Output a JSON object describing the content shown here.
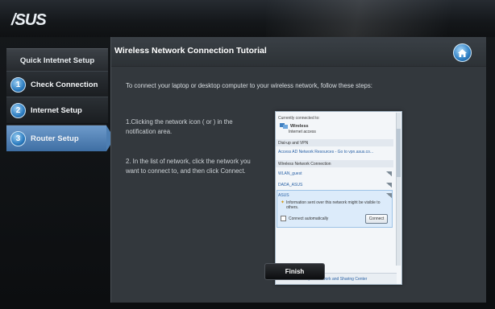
{
  "brand": {
    "logo": "/SUS"
  },
  "sidebar": {
    "header": "Quick Intetnet Setup",
    "items": [
      {
        "number": "1",
        "label": "Check Connection",
        "active": false
      },
      {
        "number": "2",
        "label": "Internet Setup",
        "active": false
      },
      {
        "number": "3",
        "label": "Router Setup",
        "active": true
      }
    ]
  },
  "main": {
    "title": "Wireless Network Connection Tutorial",
    "home_icon": "home-icon",
    "intro": "To connect your laptop or desktop computer to your wireless network, follow these steps:",
    "step1": "1.Clicking the network icon ( or ) in the notification area.",
    "step2": "2. In the list of network, click the network you want to connect to, and then click Connect.",
    "finish_label": "Finish"
  },
  "network_popup": {
    "currently_connected": "Currently connected to:",
    "connection_name": "Wireless",
    "connection_status": "Internet access",
    "dialup_header": "Dial-up and VPN",
    "dialup_item": "Access AD Network Resources - Go to vpn.asus.co...",
    "wireless_header": "Wireless Network Connection",
    "networks": [
      "WLAN_guest",
      "DADA_ASUS",
      "ASUS"
    ],
    "warning": "Information sent over this network might be visible to others.",
    "auto_connect_label": "Connect automatically",
    "connect_button": "Connect",
    "footer_link": "Open Network and Sharing Center"
  }
}
